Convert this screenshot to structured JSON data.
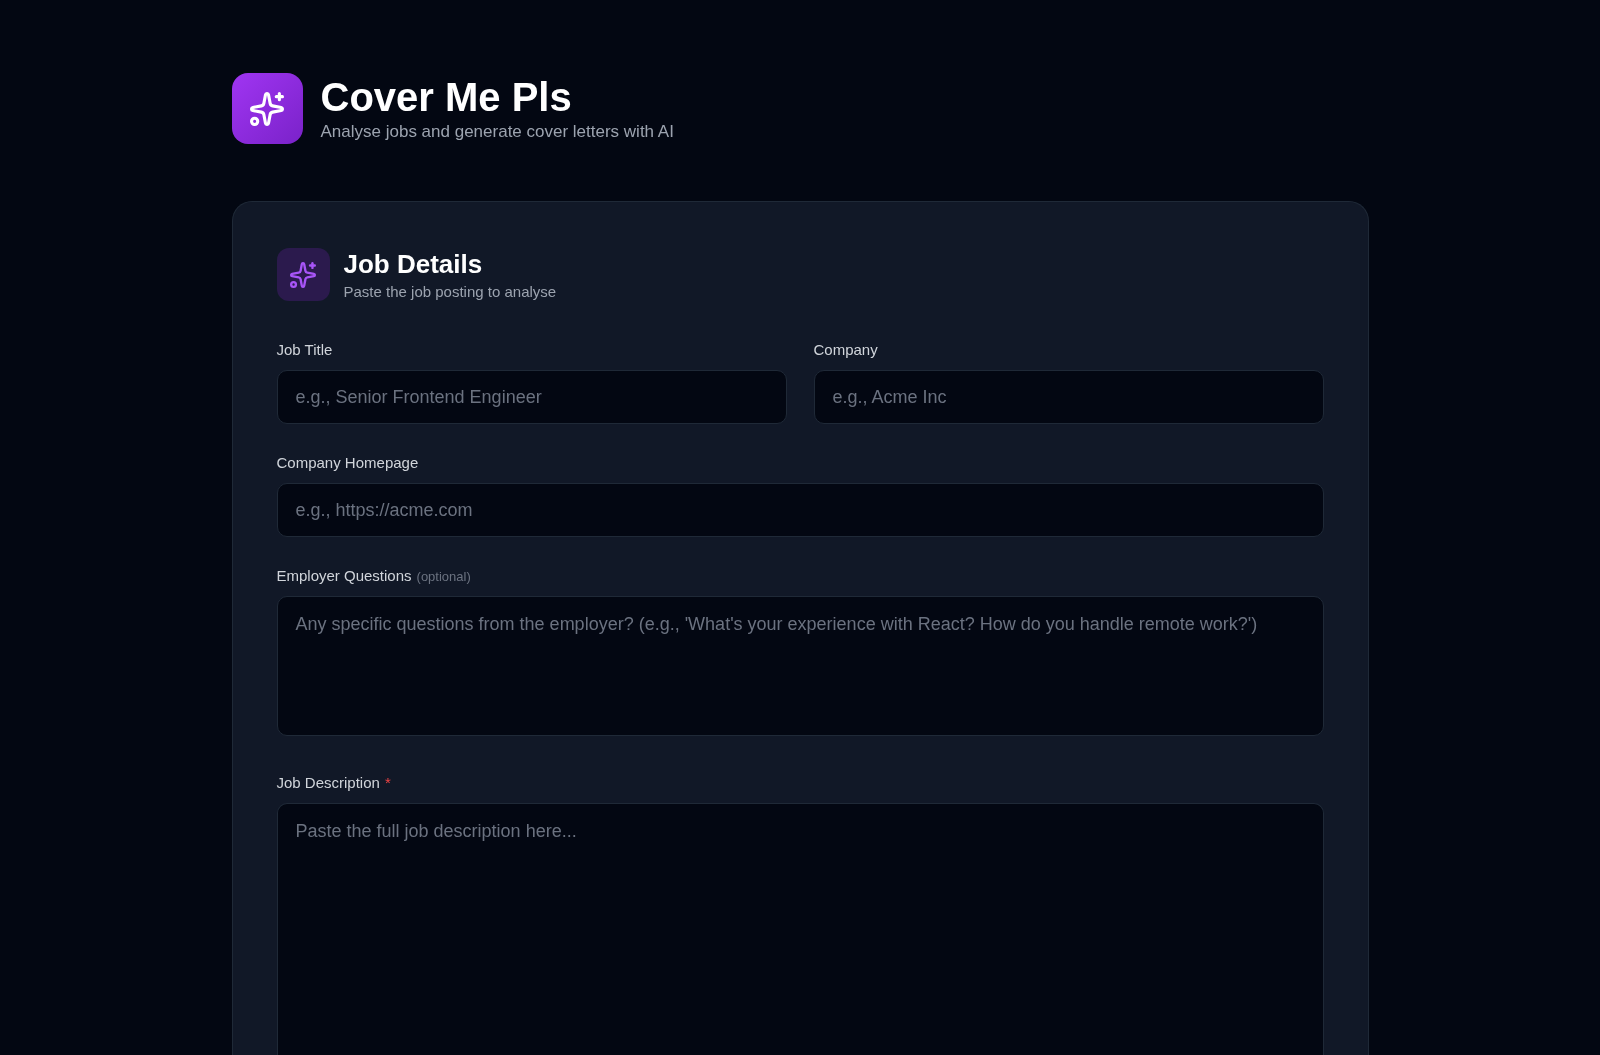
{
  "header": {
    "title": "Cover Me Pls",
    "subtitle": "Analyse jobs and generate cover letters with AI"
  },
  "card": {
    "title": "Job Details",
    "subtitle": "Paste the job posting to analyse",
    "rows": [
      [
        {
          "kind": "input",
          "label": "Job Title",
          "placeholder": "e.g., Senior Frontend Engineer"
        },
        {
          "kind": "input",
          "label": "Company",
          "placeholder": "e.g., Acme Inc"
        }
      ],
      [
        {
          "kind": "input",
          "label": "Company Homepage",
          "placeholder": "e.g., https://acme.com"
        }
      ],
      [
        {
          "kind": "textarea",
          "label": "Employer Questions",
          "note": "(optional)",
          "placeholder": "Any specific questions from the employer? (e.g., 'What's your experience with React? How do you handle remote work?')"
        }
      ],
      [
        {
          "kind": "longtext",
          "label": "Job Description",
          "required_mark": "*",
          "placeholder": "Paste the full job description here..."
        }
      ]
    ]
  }
}
